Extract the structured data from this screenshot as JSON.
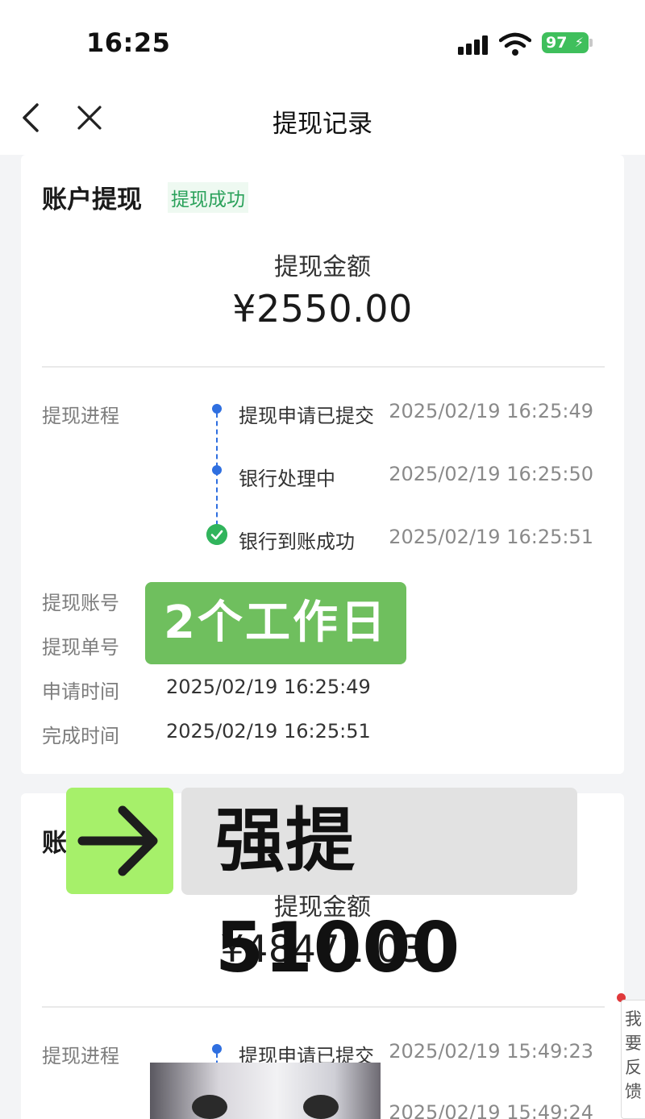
{
  "status_bar": {
    "time": "16:25",
    "battery": "97"
  },
  "nav": {
    "title": "提现记录"
  },
  "records": [
    {
      "title": "账户提现",
      "status": "提现成功",
      "amount_label": "提现金额",
      "amount": "¥2550.00",
      "progress_label": "提现进程",
      "steps": [
        {
          "name": "提现申请已提交",
          "time": "2025/02/19 16:25:49"
        },
        {
          "name": "银行处理中",
          "time": "2025/02/19 16:25:50"
        },
        {
          "name": "银行到账成功",
          "time": "2025/02/19 16:25:51"
        }
      ],
      "details": [
        {
          "label": "提现账号",
          "value": ""
        },
        {
          "label": "提现单号",
          "value": ""
        },
        {
          "label": "申请时间",
          "value": "2025/02/19 16:25:49"
        },
        {
          "label": "完成时间",
          "value": "2025/02/19 16:25:51"
        }
      ]
    },
    {
      "title": "账",
      "amount_label": "提现金额",
      "amount": "¥48471.03",
      "progress_label": "提现进程",
      "steps": [
        {
          "name": "提现申请已提交",
          "time": "2025/02/19 15:49:23"
        },
        {
          "name": "",
          "time": "2025/02/19 15:49:24"
        }
      ]
    }
  ],
  "overlays": {
    "working_days": "2个工作日",
    "force_withdraw": "强提51000"
  },
  "feedback": {
    "label": "我要反馈"
  },
  "colors": {
    "success_green": "#2aa15a",
    "step_blue": "#2f6fe0",
    "overlay_green": "#6fbf5e",
    "arrow_box": "#a6f06a"
  }
}
